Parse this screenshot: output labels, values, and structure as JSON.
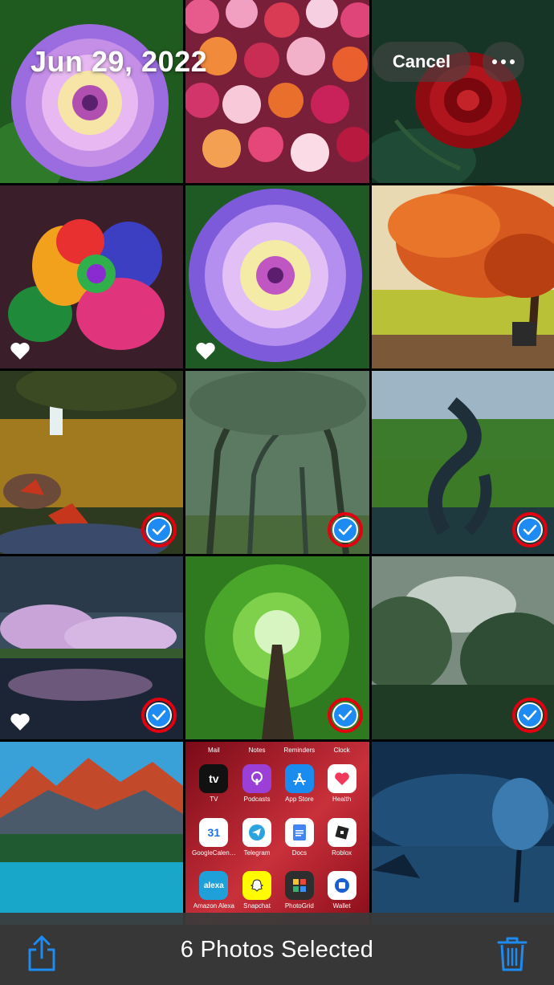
{
  "header": {
    "date": "Jun 29, 2022",
    "cancel_label": "Cancel",
    "more_icon": "ellipsis-icon"
  },
  "toolbar": {
    "selection_count": "6 Photos Selected",
    "share_icon": "share-icon",
    "delete_icon": "trash-icon",
    "accent_color": "#1d8bf2"
  },
  "photos": [
    {
      "subject": "purple dahlia",
      "favorite": false,
      "selected": false
    },
    {
      "subject": "dahlia field",
      "favorite": false,
      "selected": false
    },
    {
      "subject": "red rose",
      "favorite": false,
      "selected": false
    },
    {
      "subject": "rainbow rose",
      "favorite": true,
      "selected": false
    },
    {
      "subject": "purple dahlia",
      "favorite": true,
      "selected": false
    },
    {
      "subject": "autumn tree",
      "favorite": false,
      "selected": false
    },
    {
      "subject": "waterfall lake",
      "favorite": false,
      "selected": true
    },
    {
      "subject": "tree tunnel",
      "favorite": false,
      "selected": true
    },
    {
      "subject": "twisted tree",
      "favorite": false,
      "selected": true
    },
    {
      "subject": "cherry blossom lake",
      "favorite": true,
      "selected": true
    },
    {
      "subject": "forest canopy",
      "favorite": false,
      "selected": true
    },
    {
      "subject": "misty forest",
      "favorite": false,
      "selected": true
    },
    {
      "subject": "mountain lake",
      "favorite": false,
      "selected": false
    },
    {
      "subject": "home screen",
      "favorite": false,
      "selected": false
    },
    {
      "subject": "night landscape",
      "favorite": false,
      "selected": false
    }
  ],
  "home_screen": {
    "top_labels": [
      "Mail",
      "Notes",
      "Reminders",
      "Clock"
    ],
    "row1": [
      "TV",
      "Podcasts",
      "App Store",
      "Health"
    ],
    "row2": [
      "GoogleCalen…",
      "Telegram",
      "Docs",
      "Roblox"
    ],
    "row3": [
      "Amazon Alexa",
      "Snapchat",
      "PhotoGrid",
      "Wallet"
    ],
    "icon_text": {
      "tv": "tv",
      "calendar": "31",
      "alexa": "alexa"
    }
  }
}
